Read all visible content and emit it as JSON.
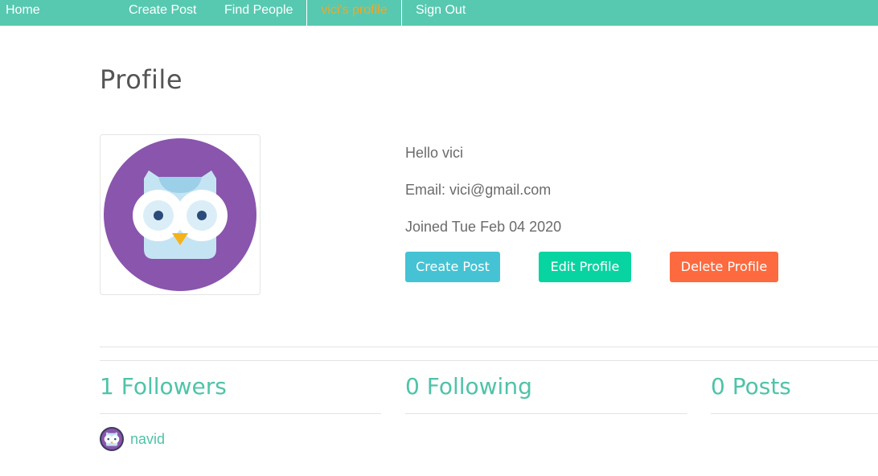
{
  "nav": {
    "home": "Home",
    "create_post": "Create Post",
    "find_people": "Find People",
    "profile": "vici's profile",
    "sign_out": "Sign Out"
  },
  "page": {
    "title": "Profile"
  },
  "user": {
    "hello": "Hello vici",
    "email": "Email: vici@gmail.com",
    "joined": "Joined Tue Feb 04 2020",
    "avatar_icon": "owl-avatar-icon"
  },
  "actions": {
    "create_post": "Create Post",
    "edit_profile": "Edit Profile",
    "delete_profile": "Delete Profile"
  },
  "stats": {
    "followers": "1 Followers",
    "following": "0 Following",
    "posts": "0 Posts"
  },
  "followers_list": [
    {
      "name": "navid",
      "avatar_icon": "owl-avatar-icon"
    }
  ],
  "colors": {
    "navbar": "#57c9b0",
    "nav_active": "#f5a623",
    "accent": "#4fc3a8",
    "btn_create": "#45c3d4",
    "btn_edit": "#08d4a2",
    "btn_delete": "#fd6a3f",
    "avatar_bg": "#8a55ad"
  }
}
